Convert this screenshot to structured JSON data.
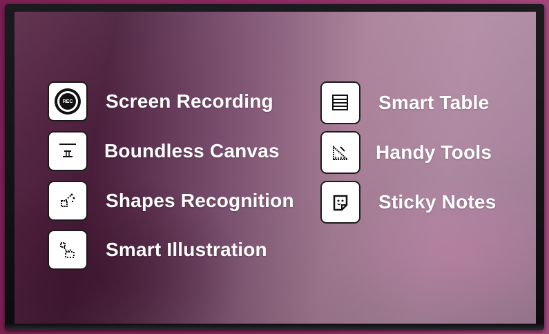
{
  "features_left": [
    {
      "label": "Screen Recording",
      "icon": "rec-icon"
    },
    {
      "label": "Boundless Canvas",
      "icon": "canvas-icon"
    },
    {
      "label": "Shapes Recognition",
      "icon": "shapes-icon"
    },
    {
      "label": "Smart Illustration",
      "icon": "illustration-icon"
    }
  ],
  "features_right": [
    {
      "label": "Smart Table",
      "icon": "table-icon"
    },
    {
      "label": "Handy Tools",
      "icon": "ruler-icon"
    },
    {
      "label": "Sticky Notes",
      "icon": "sticky-note-icon"
    }
  ],
  "rec_badge_text": "REC",
  "colors": {
    "accent_text": "#ffffff",
    "icon_bg": "#ffffff",
    "frame": "#111111"
  }
}
